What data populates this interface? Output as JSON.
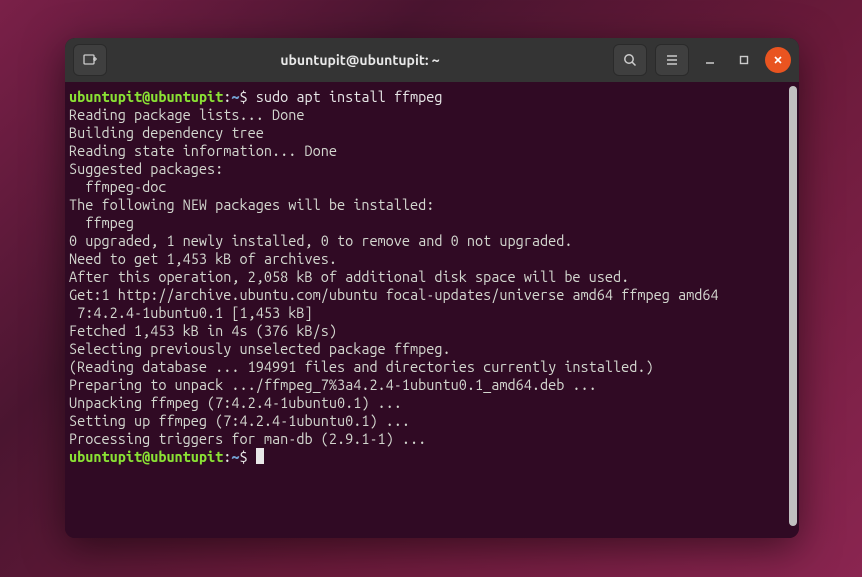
{
  "titlebar": {
    "title": "ubuntupit@ubuntupit: ~"
  },
  "prompt": {
    "user_host": "ubuntupit@ubuntupit",
    "separator": ":",
    "path": "~",
    "dollar": "$"
  },
  "commands": {
    "cmd1": " sudo apt install ffmpeg"
  },
  "output": {
    "l1": "Reading package lists... Done",
    "l2": "Building dependency tree",
    "l3": "Reading state information... Done",
    "l4": "Suggested packages:",
    "l5": "  ffmpeg-doc",
    "l6": "The following NEW packages will be installed:",
    "l7": "  ffmpeg",
    "l8": "0 upgraded, 1 newly installed, 0 to remove and 0 not upgraded.",
    "l9": "Need to get 1,453 kB of archives.",
    "l10": "After this operation, 2,058 kB of additional disk space will be used.",
    "l11": "Get:1 http://archive.ubuntu.com/ubuntu focal-updates/universe amd64 ffmpeg amd64",
    "l12": " 7:4.2.4-1ubuntu0.1 [1,453 kB]",
    "l13": "Fetched 1,453 kB in 4s (376 kB/s)",
    "l14": "Selecting previously unselected package ffmpeg.",
    "l15": "(Reading database ... 194991 files and directories currently installed.)",
    "l16": "Preparing to unpack .../ffmpeg_7%3a4.2.4-1ubuntu0.1_amd64.deb ...",
    "l17": "Unpacking ffmpeg (7:4.2.4-1ubuntu0.1) ...",
    "l18": "Setting up ffmpeg (7:4.2.4-1ubuntu0.1) ...",
    "l19": "Processing triggers for man-db (2.9.1-1) ..."
  }
}
